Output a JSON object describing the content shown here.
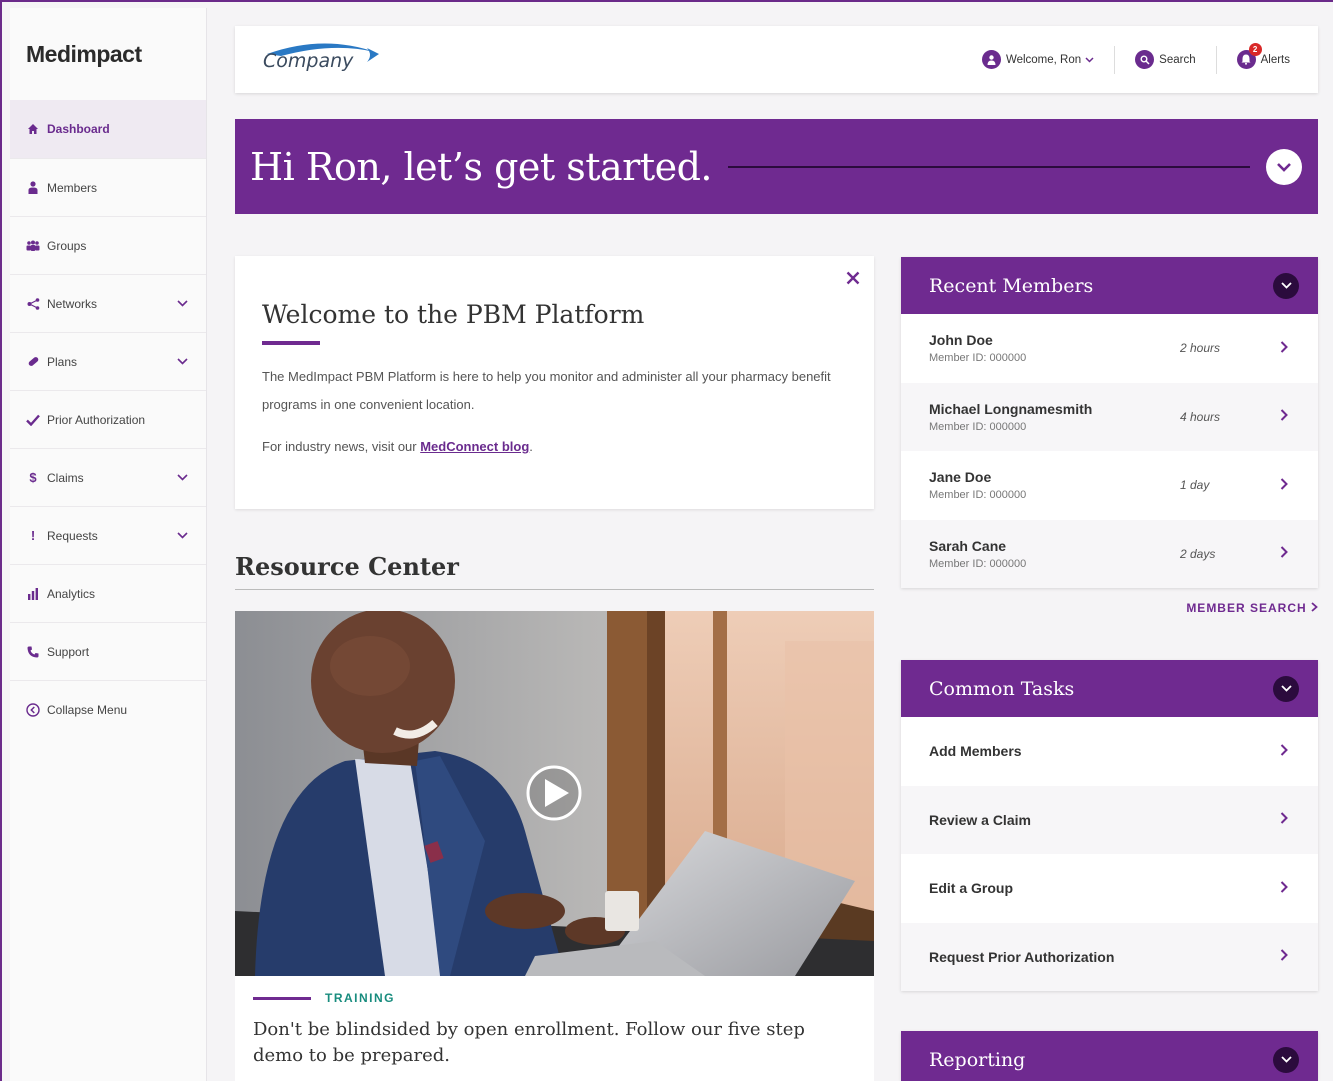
{
  "sidebar": {
    "brand": "Medimpact",
    "items": [
      {
        "label": "Dashboard",
        "icon": "home-icon",
        "active": true,
        "expandable": false
      },
      {
        "label": "Members",
        "icon": "person-icon",
        "active": false,
        "expandable": false
      },
      {
        "label": "Groups",
        "icon": "group-icon",
        "active": false,
        "expandable": false
      },
      {
        "label": "Networks",
        "icon": "share-icon",
        "active": false,
        "expandable": true
      },
      {
        "label": "Plans",
        "icon": "pill-icon",
        "active": false,
        "expandable": true
      },
      {
        "label": "Prior Authorization",
        "icon": "check-icon",
        "active": false,
        "expandable": false
      },
      {
        "label": "Claims",
        "icon": "dollar-icon",
        "active": false,
        "expandable": true
      },
      {
        "label": "Requests",
        "icon": "exclamation-icon",
        "active": false,
        "expandable": true
      },
      {
        "label": "Analytics",
        "icon": "bar-chart-icon",
        "active": false,
        "expandable": false
      },
      {
        "label": "Support",
        "icon": "phone-icon",
        "active": false,
        "expandable": false
      },
      {
        "label": "Collapse Menu",
        "icon": "collapse-icon",
        "active": false,
        "expandable": false
      }
    ]
  },
  "header": {
    "company_logo_text": "Company",
    "welcome_label": "Welcome, Ron",
    "search_label": "Search",
    "alerts_label": "Alerts",
    "alerts_count": "2"
  },
  "hero": {
    "greeting": "Hi Ron, let’s get started."
  },
  "welcome_card": {
    "title": "Welcome to the PBM Platform",
    "body": "The MedImpact PBM Platform is here to help you monitor and administer all your pharmacy benefit programs in one convenient location.",
    "news_prefix": "For industry news, visit our ",
    "news_link": "MedConnect blog",
    "news_suffix": "."
  },
  "resource_center": {
    "title": "Resource Center",
    "tag": "TRAINING",
    "description": "Don't be blindsided by open enrollment. Follow our five step demo to be prepared."
  },
  "recent_members": {
    "title": "Recent Members",
    "rows": [
      {
        "name": "John Doe",
        "member_id": "Member ID: 000000",
        "ago": "2 hours"
      },
      {
        "name": "Michael Longnamesmith",
        "member_id": "Member ID: 000000",
        "ago": "4 hours"
      },
      {
        "name": "Jane Doe",
        "member_id": "Member ID: 000000",
        "ago": "1 day"
      },
      {
        "name": "Sarah Cane",
        "member_id": "Member ID: 000000",
        "ago": "2 days"
      }
    ],
    "search_link": "MEMBER SEARCH"
  },
  "common_tasks": {
    "title": "Common Tasks",
    "items": [
      "Add Members",
      "Review a Claim",
      "Edit a Group",
      "Request Prior Authorization"
    ]
  },
  "reporting": {
    "title": "Reporting"
  },
  "colors": {
    "brand_purple": "#6f2a90",
    "dark_purple": "#2b0b3d",
    "training_teal": "#188c7e",
    "alert_red": "#d92828"
  }
}
